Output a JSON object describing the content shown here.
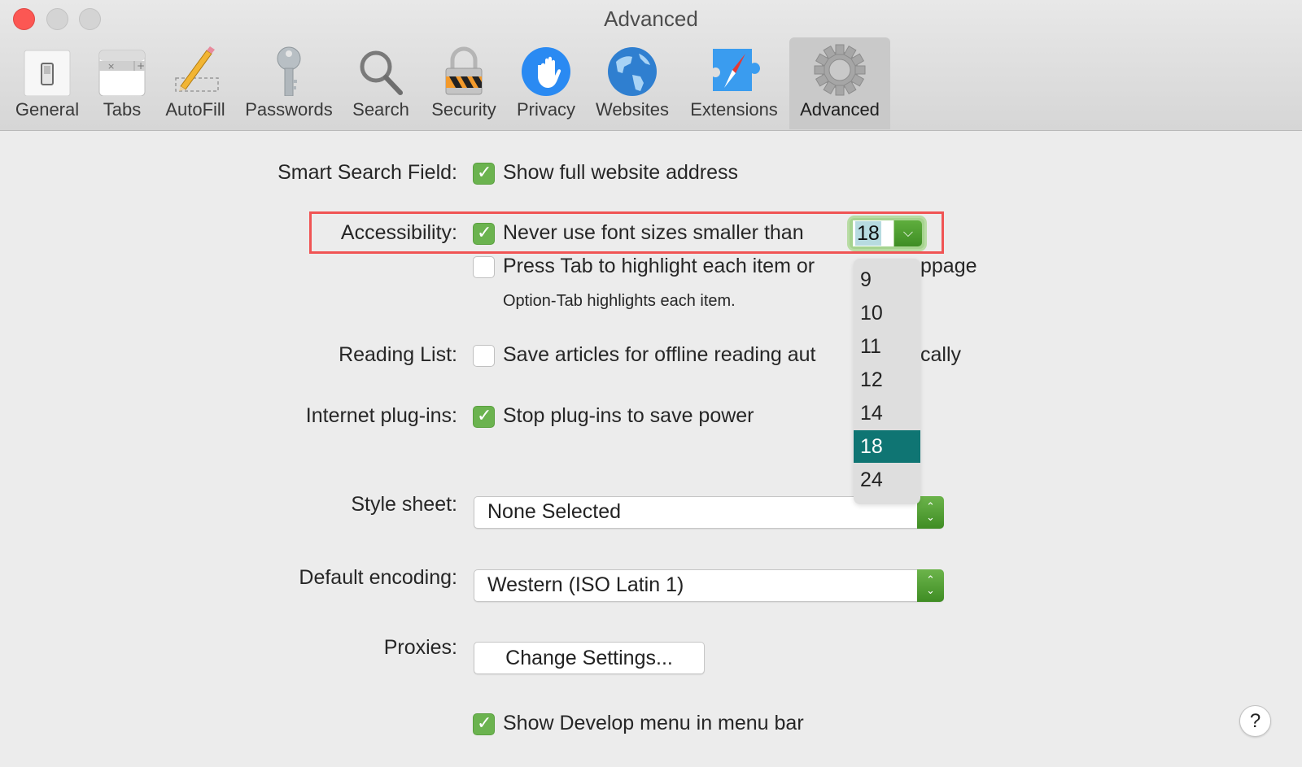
{
  "window": {
    "title": "Advanced"
  },
  "toolbar": {
    "items": [
      {
        "label": "General",
        "icon": "switch-icon",
        "selected": false
      },
      {
        "label": "Tabs",
        "icon": "tabs-icon",
        "selected": false
      },
      {
        "label": "AutoFill",
        "icon": "pencil-icon",
        "selected": false
      },
      {
        "label": "Passwords",
        "icon": "key-icon",
        "selected": false
      },
      {
        "label": "Search",
        "icon": "magnifier-icon",
        "selected": false
      },
      {
        "label": "Security",
        "icon": "padlock-icon",
        "selected": false
      },
      {
        "label": "Privacy",
        "icon": "hand-icon",
        "selected": false
      },
      {
        "label": "Websites",
        "icon": "globe-icon",
        "selected": false
      },
      {
        "label": "Extensions",
        "icon": "puzzle-compass-icon",
        "selected": false
      },
      {
        "label": "Advanced",
        "icon": "gear-icon",
        "selected": true
      }
    ]
  },
  "settings": {
    "smart_search": {
      "label": "Smart Search Field:",
      "option": "Show full website address",
      "checked": true
    },
    "accessibility": {
      "label": "Accessibility:",
      "option": "Never use font sizes smaller than",
      "checked": true,
      "font_size_value": "18",
      "font_size_options": [
        "9",
        "10",
        "11",
        "12",
        "14",
        "18",
        "24"
      ],
      "font_size_selected": "18",
      "tab_option": "Press Tab to highlight each item on a webpage",
      "tab_option_visible_left": "Press Tab to highlight each item or",
      "tab_option_visible_right": "ppage",
      "tab_checked": false,
      "tab_note": "Option-Tab highlights each item."
    },
    "reading_list": {
      "label": "Reading List:",
      "option_visible_left": "Save articles for offline reading aut",
      "option_visible_right": "cally",
      "checked": false
    },
    "plugins": {
      "label": "Internet plug-ins:",
      "option": "Stop plug-ins to save power",
      "checked": true
    },
    "style_sheet": {
      "label": "Style sheet:",
      "value": "None Selected"
    },
    "encoding": {
      "label": "Default encoding:",
      "value": "Western (ISO Latin 1)"
    },
    "proxies": {
      "label": "Proxies:",
      "button": "Change Settings..."
    },
    "develop": {
      "option": "Show Develop menu in menu bar",
      "checked": true
    }
  },
  "help": {
    "label": "?"
  },
  "colors": {
    "checkbox_accent": "#6bb34f",
    "menu_selection": "#0f7573",
    "annotation_box": "#f05454"
  }
}
